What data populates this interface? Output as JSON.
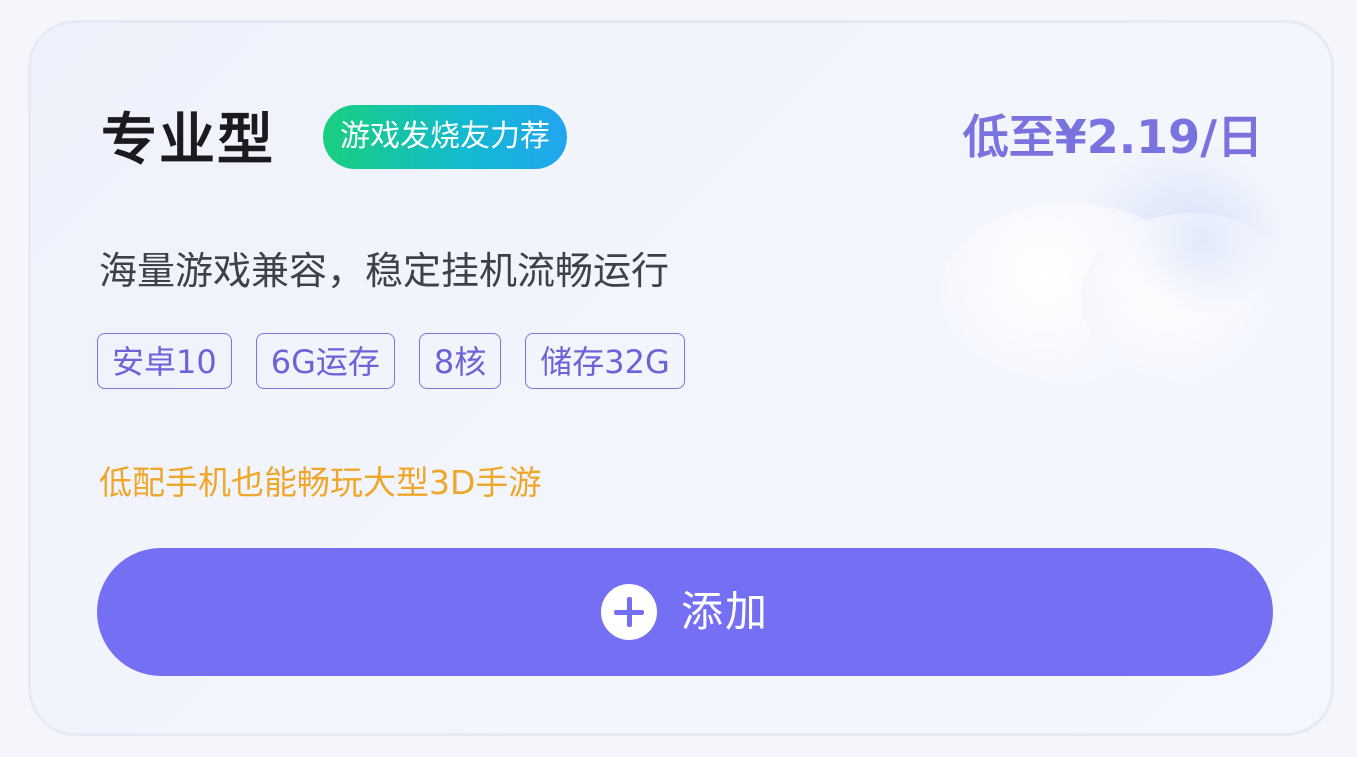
{
  "card": {
    "title": "专业型",
    "badge": "游戏发烧友力荐",
    "price": "低至¥2.19/日",
    "description": "海量游戏兼容，稳定挂机流畅运行",
    "tags": [
      "安卓10",
      "6G运存",
      "8核",
      "储存32G"
    ],
    "highlight": "低配手机也能畅玩大型3D手游",
    "add_button_label": "添加"
  },
  "colors": {
    "accent": "#7570f3",
    "price": "#7a72df",
    "highlight": "#eea72b",
    "badge_start": "#19cf7d",
    "badge_end": "#21a5ef"
  },
  "icons": {
    "add": "plus-circle-icon",
    "decoration": "cloud-icon"
  }
}
